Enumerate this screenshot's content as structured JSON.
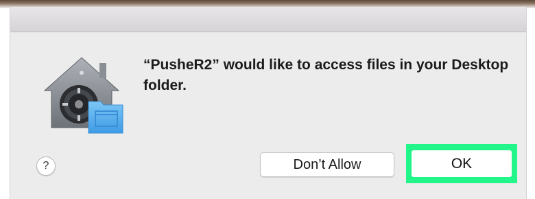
{
  "dialog": {
    "message": "“PusheR2” would like to access files in your Desktop folder.",
    "icon": "privacy-lock-folder-icon"
  },
  "buttons": {
    "help_label": "?",
    "dont_allow_label": "Don’t Allow",
    "ok_label": "OK"
  },
  "colors": {
    "highlight": "#22f58a",
    "dialog_bg": "#ececec",
    "folder_blue": "#5fb3ef"
  }
}
